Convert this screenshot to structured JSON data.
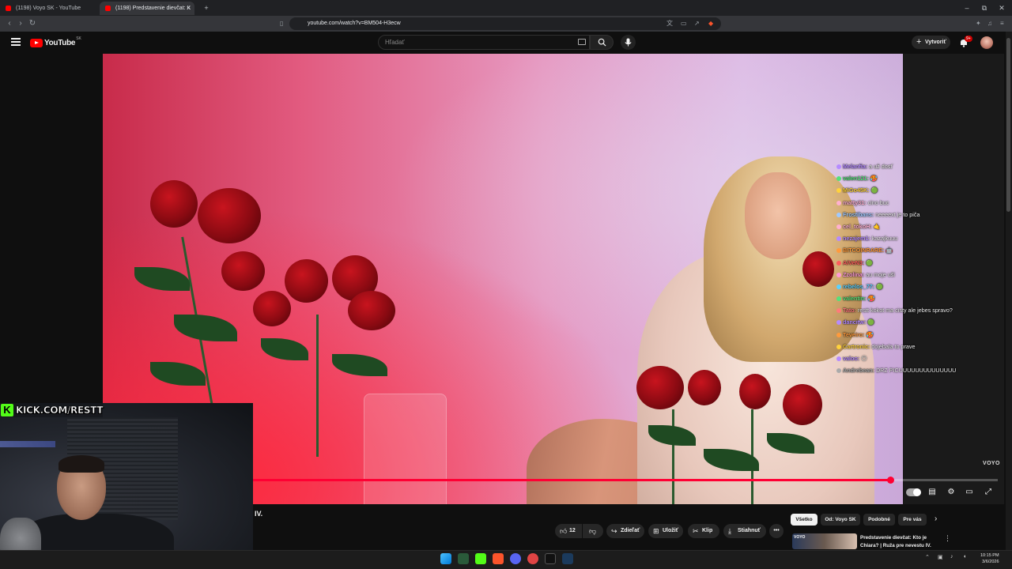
{
  "browser": {
    "tabs": [
      {
        "label": "(1198) Voyo SK - YouTube",
        "active": false
      },
      {
        "label": "(1198) Predstavenie dievčat: K",
        "active": true
      }
    ],
    "new_tab_label": "+",
    "url": "youtube.com/watch?v=BM504-H3ecw",
    "window_controls": {
      "minimize": "–",
      "maximize": "⧉",
      "close": "✕"
    }
  },
  "youtube": {
    "logo_text": "YouTube",
    "country_code": "SK",
    "search_placeholder": "Hľadať",
    "create_label": "Vytvoriť",
    "notification_count": "9+"
  },
  "player": {
    "watermark": "VOYO",
    "progress_fraction": 0.856,
    "autoplay_on": true
  },
  "chat": [
    {
      "user": "Melanfia:",
      "text": "a už dosť",
      "color": "#b58bff"
    },
    {
      "user": "valen121:",
      "text": "🥵",
      "color": "#55e07a"
    },
    {
      "user": "MiGo45K:",
      "text": "🟢",
      "color": "#ffd23c"
    },
    {
      "user": "matty31:",
      "text": "cino buc",
      "color": "#ffb0d0"
    },
    {
      "user": "Frostibans:",
      "text": "neeeext je to piča",
      "color": "#9ec9ff"
    },
    {
      "user": "cel_tokoH:",
      "text": "🤙",
      "color": "#ffb0d0"
    },
    {
      "user": "nezajem1:",
      "text": "kazajkuuu",
      "color": "#b58bff"
    },
    {
      "user": "BITCOINRARE:",
      "text": "🤖",
      "color": "#ff9a3c"
    },
    {
      "user": "AiVeN3:",
      "text": "🟢",
      "color": "#ff5c5c"
    },
    {
      "user": "Zzolina:",
      "text": "au moje uši",
      "color": "#ff9ad8"
    },
    {
      "user": "rebelos_77:",
      "text": "🟢",
      "color": "#5ad1ff"
    },
    {
      "user": "valentin:",
      "text": "🥵",
      "color": "#55e07a"
    },
    {
      "user": "Tato:",
      "text": "restt kokot ma cisty ale jebes spravo?",
      "color": "#ff7a7a"
    },
    {
      "user": "dancitw:",
      "text": "🟢",
      "color": "#b58bff"
    },
    {
      "user": "Teveiro:",
      "text": "🥵",
      "color": "#ff9a3c"
    },
    {
      "user": "Cartronic:",
      "text": "dojebala to prave",
      "color": "#ffd23c"
    },
    {
      "user": "valoo:",
      "text": "😶",
      "color": "#b58bff"
    },
    {
      "user": "Andrebean:",
      "text": "DRZ PICUUUUUUUUUUUUUU",
      "color": "#aaaaaa"
    }
  ],
  "webcam": {
    "kick_text": "KICK.COM/RESTT",
    "kick_letter": "K"
  },
  "below": {
    "title_fragment": "IV.",
    "actions": {
      "like_count": "12",
      "share": "Zdieľať",
      "save": "Uložiť",
      "clip": "Klip",
      "download": "Stiahnuť"
    },
    "chips": [
      "Všetko",
      "Od: Voyo SK",
      "Podobné",
      "Pre vás"
    ],
    "recommendation": {
      "channel_badge": "VOYO",
      "title": "Predstavenie dievčat: Kto je Chiara? | Ruža pre nevestu IV."
    }
  },
  "taskbar": {
    "time": "10:15 PM",
    "date": "3/6/2026"
  },
  "colors": {
    "youtube_red": "#ff0000",
    "progress_red": "#ff0033",
    "kick_green": "#53fc18"
  }
}
